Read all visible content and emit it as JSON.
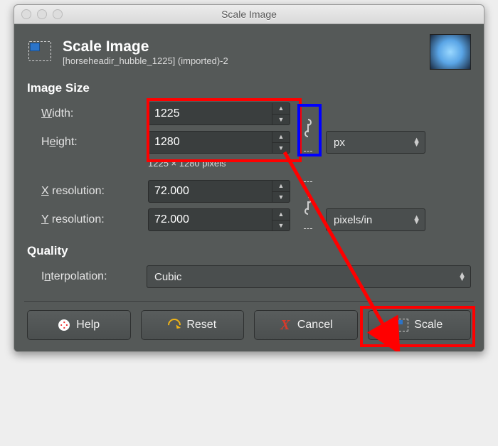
{
  "titlebar": "Scale Image",
  "header": {
    "title": "Scale Image",
    "subtitle": "[horseheadir_hubble_1225] (imported)-2"
  },
  "sections": {
    "size": "Image Size",
    "quality": "Quality"
  },
  "labels": {
    "width": "Width:",
    "height": "Height:",
    "xres": "X resolution:",
    "yres": "Y resolution:",
    "interp": "Interpolation:"
  },
  "values": {
    "width": "1225",
    "height": "1280",
    "xres": "72.000",
    "yres": "72.000"
  },
  "subtext": "1225 × 1280 pixels",
  "units": {
    "size": "px",
    "res": "pixels/in"
  },
  "interp": "Cubic",
  "buttons": {
    "help": "Help",
    "reset": "Reset",
    "cancel": "Cancel",
    "scale": "Scale"
  }
}
